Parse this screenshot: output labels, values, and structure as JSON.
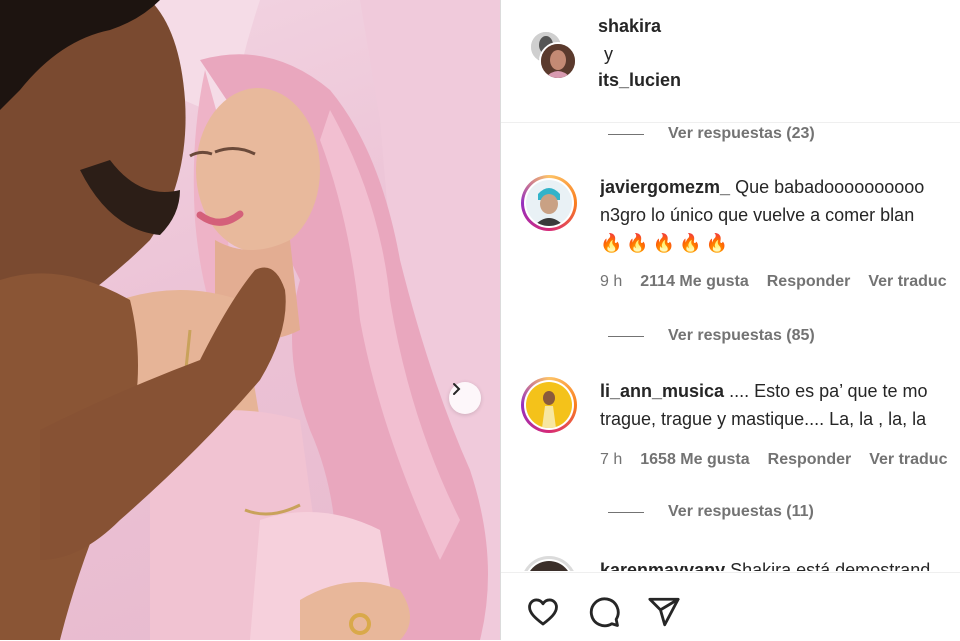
{
  "post": {
    "author": "shakira",
    "conjunction": "y",
    "collaborator": "its_lucien"
  },
  "comments": [
    {
      "username": "javiergomezm_",
      "text": "Que babadoooooooooo",
      "text_line2": "n3gro lo único que vuelve a comer blan",
      "emoji_line": "🔥🔥🔥🔥🔥",
      "time": "9 h",
      "likes": "2114 Me gusta",
      "reply": "Responder",
      "translate": "Ver traduc",
      "view_replies": "Ver respuestas (85)"
    },
    {
      "username": "li_ann_musica",
      "text": ".... Esto es pa’ que te mo",
      "text_line2": "trague, trague y mastique.... La, la , la, la",
      "time": "7 h",
      "likes": "1658 Me gusta",
      "reply": "Responder",
      "translate": "Ver traduc",
      "view_replies": "Ver respuestas (11)"
    },
    {
      "username": "karenmayvany",
      "text": "Shakira está demostrand"
    }
  ],
  "top_view_replies": "Ver respuestas (23)",
  "icons": {
    "next": "chevron-right-icon",
    "like": "heart-icon",
    "comment": "comment-icon",
    "share": "send-icon"
  },
  "colors": {
    "text": "#262626",
    "muted": "#737373",
    "photo_bg": "#ecc3d6"
  }
}
